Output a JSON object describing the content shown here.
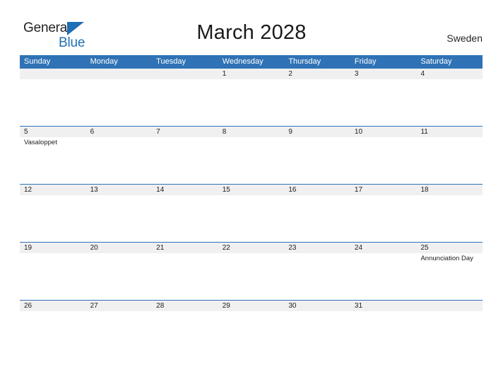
{
  "brand": {
    "name_part1": "General",
    "name_part2": "Blue",
    "triangle_icon": "triangle-icon",
    "color_dark": "#232323",
    "color_blue": "#1f6fb4"
  },
  "header": {
    "title": "March 2028",
    "region": "Sweden"
  },
  "calendar": {
    "header_bg": "#2f72b5",
    "band_bg": "#f0f0f0",
    "weekdays": [
      "Sunday",
      "Monday",
      "Tuesday",
      "Wednesday",
      "Thursday",
      "Friday",
      "Saturday"
    ],
    "weeks": [
      {
        "days": [
          {
            "number": "",
            "events": []
          },
          {
            "number": "",
            "events": []
          },
          {
            "number": "",
            "events": []
          },
          {
            "number": "1",
            "events": []
          },
          {
            "number": "2",
            "events": []
          },
          {
            "number": "3",
            "events": []
          },
          {
            "number": "4",
            "events": []
          }
        ]
      },
      {
        "days": [
          {
            "number": "5",
            "events": [
              "Vasaloppet"
            ]
          },
          {
            "number": "6",
            "events": []
          },
          {
            "number": "7",
            "events": []
          },
          {
            "number": "8",
            "events": []
          },
          {
            "number": "9",
            "events": []
          },
          {
            "number": "10",
            "events": []
          },
          {
            "number": "11",
            "events": []
          }
        ]
      },
      {
        "days": [
          {
            "number": "12",
            "events": []
          },
          {
            "number": "13",
            "events": []
          },
          {
            "number": "14",
            "events": []
          },
          {
            "number": "15",
            "events": []
          },
          {
            "number": "16",
            "events": []
          },
          {
            "number": "17",
            "events": []
          },
          {
            "number": "18",
            "events": []
          }
        ]
      },
      {
        "days": [
          {
            "number": "19",
            "events": []
          },
          {
            "number": "20",
            "events": []
          },
          {
            "number": "21",
            "events": []
          },
          {
            "number": "22",
            "events": []
          },
          {
            "number": "23",
            "events": []
          },
          {
            "number": "24",
            "events": []
          },
          {
            "number": "25",
            "events": [
              "Annunciation Day"
            ]
          }
        ]
      },
      {
        "days": [
          {
            "number": "26",
            "events": []
          },
          {
            "number": "27",
            "events": []
          },
          {
            "number": "28",
            "events": []
          },
          {
            "number": "29",
            "events": []
          },
          {
            "number": "30",
            "events": []
          },
          {
            "number": "31",
            "events": []
          },
          {
            "number": "",
            "events": []
          }
        ]
      }
    ]
  }
}
